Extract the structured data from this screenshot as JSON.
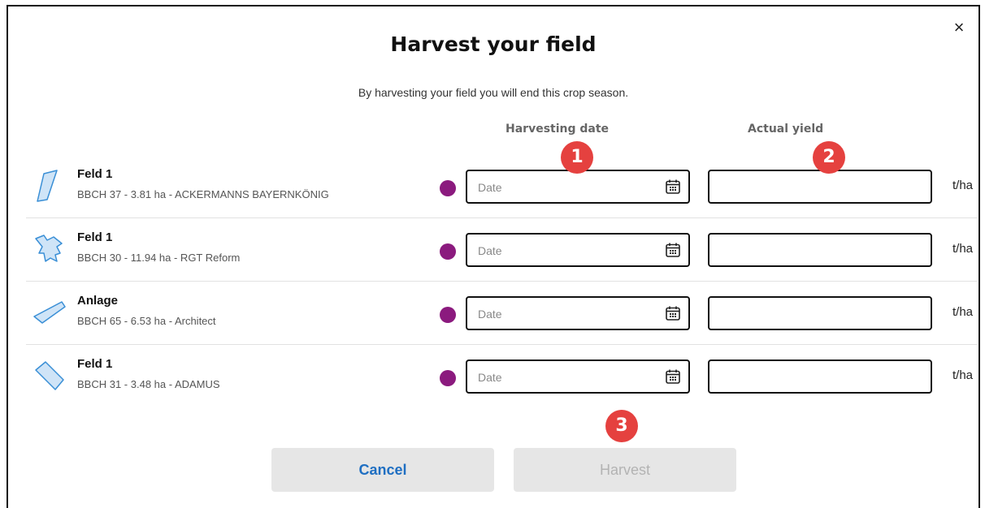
{
  "dialog": {
    "title": "Harvest your field",
    "subtitle": "By harvesting your field you will end this crop season.",
    "close_glyph": "×"
  },
  "columns": {
    "harvesting_date": "Harvesting date",
    "actual_yield": "Actual yield"
  },
  "rows": [
    {
      "name": "Feld 1",
      "meta": "BBCH 37 - 3.81 ha - ACKERMANNS BAYERNKÖNIG",
      "date_placeholder": "Date",
      "unit": "t/ha",
      "icon": "field-shape-icon"
    },
    {
      "name": "Feld 1",
      "meta": "BBCH 30 - 11.94 ha - RGT Reform",
      "date_placeholder": "Date",
      "unit": "t/ha",
      "icon": "field-shape-icon"
    },
    {
      "name": "Anlage",
      "meta": "BBCH 65 - 6.53 ha - Architect",
      "date_placeholder": "Date",
      "unit": "t/ha",
      "icon": "field-shape-icon"
    },
    {
      "name": "Feld 1",
      "meta": "BBCH 31 - 3.48 ha - ADAMUS",
      "date_placeholder": "Date",
      "unit": "t/ha",
      "icon": "field-shape-icon"
    }
  ],
  "badges": [
    "1",
    "2",
    "3"
  ],
  "buttons": {
    "cancel": "Cancel",
    "harvest": "Harvest"
  },
  "colors": {
    "crop_dot": "#8b1a7e",
    "field_fill": "#cfe4f7",
    "field_stroke": "#3a8fd6",
    "badge": "#e5413f",
    "cancel_text": "#1f6fc2"
  }
}
